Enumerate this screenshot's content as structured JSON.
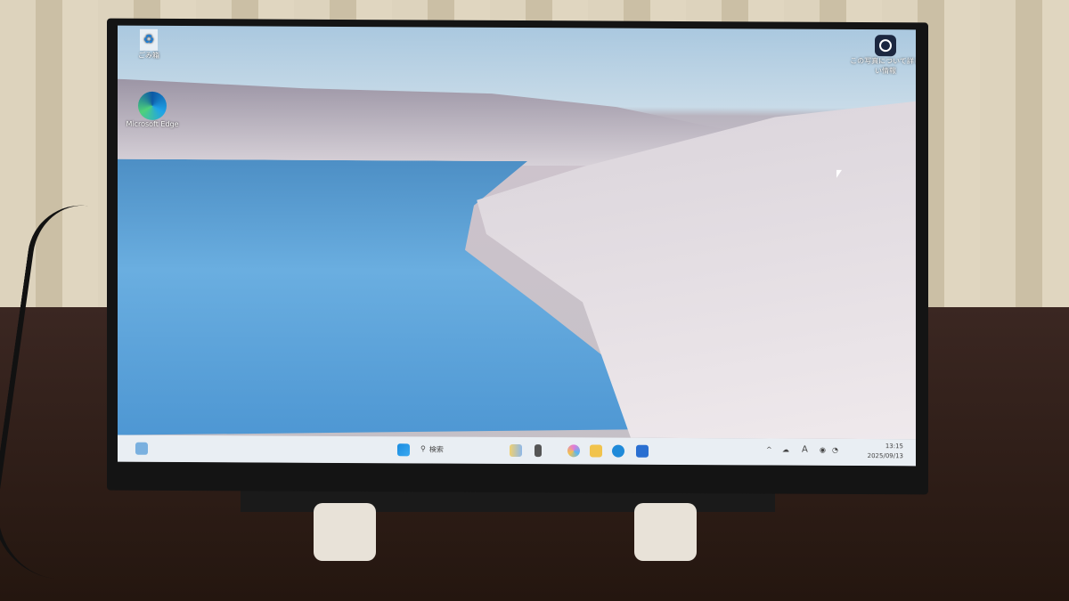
{
  "desktop": {
    "icons": [
      {
        "label": "ごみ箱",
        "icon": "recycle-bin-icon"
      },
      {
        "label": "Microsoft Edge",
        "icon": "edge-icon"
      }
    ],
    "spotlight": {
      "label": "この写真について詳しい情報",
      "icon": "spotlight-icon"
    }
  },
  "taskbar": {
    "search_placeholder": "検索",
    "apps": [
      "widgets",
      "file-explorer",
      "copilot",
      "folder",
      "edge",
      "store"
    ],
    "time": "13:15",
    "date": "2025/09/13",
    "ime": "A"
  }
}
